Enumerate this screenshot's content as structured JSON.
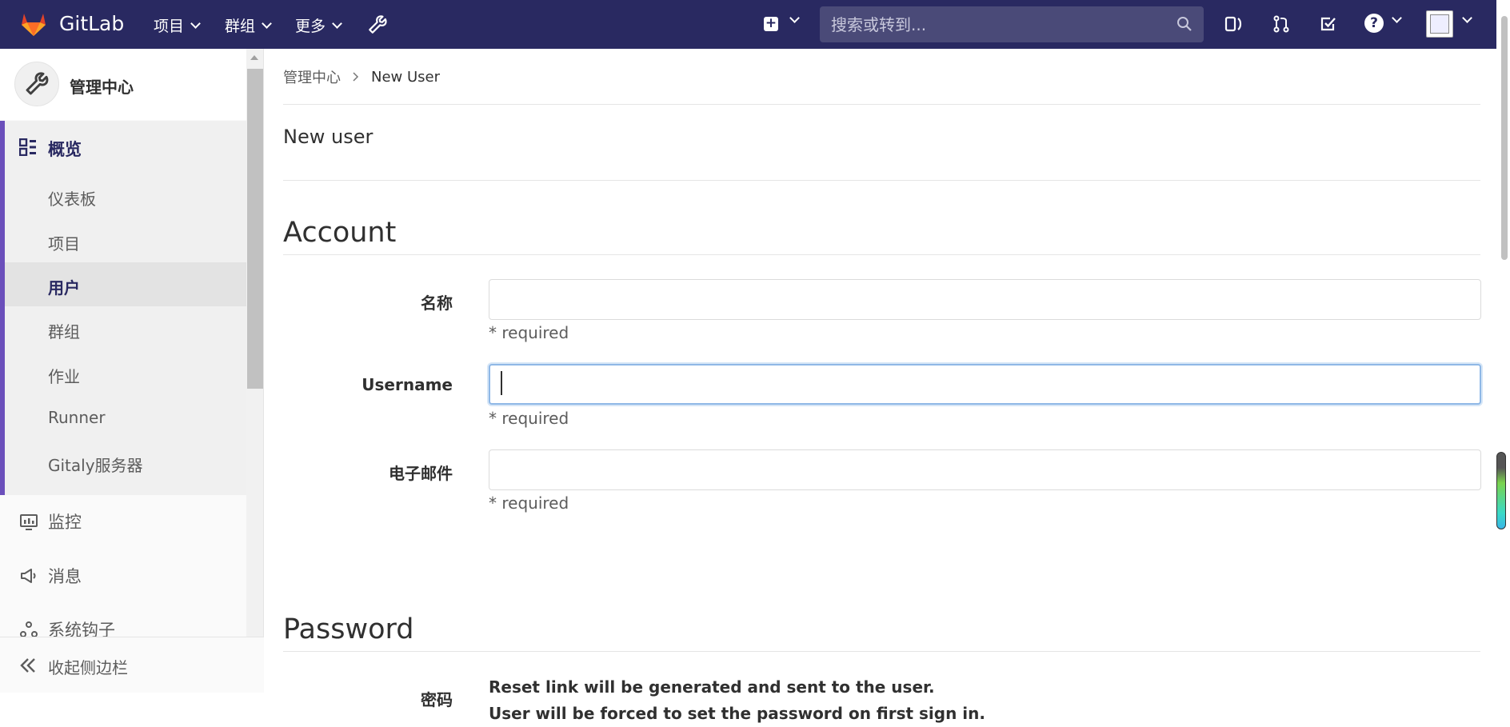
{
  "navbar": {
    "brand": "GitLab",
    "menu": [
      {
        "label": "项目"
      },
      {
        "label": "群组"
      },
      {
        "label": "更多"
      }
    ],
    "search_placeholder": "搜索或转到..."
  },
  "sidebar": {
    "title": "管理中心",
    "section_title": "概览",
    "items": [
      {
        "label": "仪表板"
      },
      {
        "label": "项目"
      },
      {
        "label": "用户"
      },
      {
        "label": "群组"
      },
      {
        "label": "作业"
      },
      {
        "label": "Runner"
      },
      {
        "label": "Gitaly服务器"
      }
    ],
    "bottom_items": [
      {
        "label": "监控"
      },
      {
        "label": "消息"
      },
      {
        "label": "系统钩子"
      }
    ],
    "collapse_label": "收起侧边栏"
  },
  "breadcrumb": {
    "parent": "管理中心",
    "current": "New User"
  },
  "page": {
    "title": "New user"
  },
  "account": {
    "title": "Account",
    "name_label": "名称",
    "name_value": "",
    "username_label": "Username",
    "username_value": "",
    "email_label": "电子邮件",
    "email_value": "",
    "required_text": "* required"
  },
  "password": {
    "title": "Password",
    "label": "密码",
    "line1": "Reset link will be generated and sent to the user.",
    "line2": "User will be forced to set the password on first sign in."
  },
  "colors": {
    "navbar_bg": "#292961",
    "active_accent": "#6b4fbb",
    "focus_border": "#8fb8e6"
  }
}
